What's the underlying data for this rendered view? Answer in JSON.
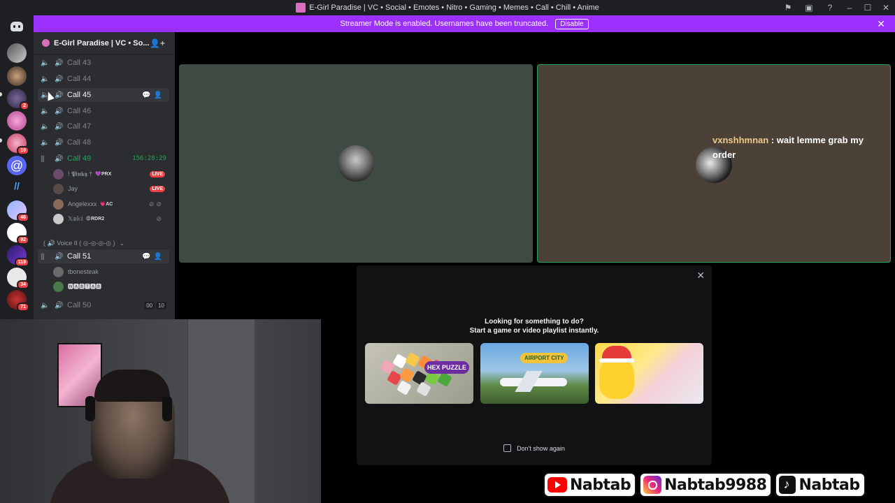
{
  "window": {
    "title": "E-Girl Paradise | VC • Social • Emotes • Nitro • Gaming • Memes • Call • Chill • Anime",
    "controls": {
      "minimize": "–",
      "maximize": "☐",
      "close": "✕"
    }
  },
  "banner": {
    "text": "Streamer Mode is enabled. Usernames have been truncated.",
    "disable_label": "Disable",
    "color": "#9b30ff"
  },
  "rail": {
    "servers": [
      {
        "name": "server-1"
      },
      {
        "name": "server-2"
      },
      {
        "name": "server-3",
        "badge": "2"
      },
      {
        "name": "server-4"
      },
      {
        "name": "server-5",
        "badge": "10"
      },
      {
        "name": "server-6"
      },
      {
        "name": "server-7"
      },
      {
        "name": "server-8",
        "badge": "46"
      },
      {
        "name": "server-9",
        "badge": "92"
      },
      {
        "name": "server-10",
        "badge": "119"
      },
      {
        "name": "server-11",
        "badge": "34"
      },
      {
        "name": "server-12",
        "badge": "71"
      }
    ]
  },
  "sidebar": {
    "server_name": "E-Girl Paradise | VC • So...",
    "channels_top": [
      {
        "label": "Call 43"
      },
      {
        "label": "Call 44"
      },
      {
        "label": "Call 45"
      },
      {
        "label": "Call 46"
      },
      {
        "label": "Call 47"
      },
      {
        "label": "Call 48"
      }
    ],
    "active_call": {
      "label": "Call 49",
      "timer": "156:28:29",
      "members": [
        {
          "name": "! 𝕻𝖎𝖓𝖐𝖞 †",
          "tag": "💜PRX",
          "live": "LIVE"
        },
        {
          "name": "Jay",
          "live": "LIVE"
        },
        {
          "name": "Angelexxx",
          "tag": "💗AC"
        },
        {
          "name": "𝕏𝕠𝕜𝕚",
          "tag": "😡RDR2"
        }
      ]
    },
    "category": "( 🔊 Voice II ( ◎-◎-◎-◎ )",
    "call51": {
      "label": "Call 51",
      "members": [
        {
          "name": "tbonesteak"
        },
        {
          "name": "🅽🅰🅱🆃🅰🅱"
        }
      ]
    },
    "call50": {
      "label": "Call 50",
      "count_current": "00",
      "count_max": "10"
    }
  },
  "main": {
    "chat_user": "vxnshhmnan",
    "chat_message": " : wait lemme grab my order",
    "activity": {
      "title_line1": "Looking for something to do?",
      "title_line2": "Start a game or video playlist instantly.",
      "games": [
        {
          "name": "Hex Puzzle",
          "badge": "HEX PUZZLE"
        },
        {
          "name": "Airport City",
          "badge": "AIRPORT CITY"
        },
        {
          "name": "Chick holiday game"
        }
      ],
      "dont_show": "Don't show again"
    }
  },
  "socials": [
    {
      "platform": "youtube",
      "handle": "Nabtab"
    },
    {
      "platform": "instagram",
      "handle": "Nabtab9988"
    },
    {
      "platform": "tiktok",
      "handle": "Nabtab"
    }
  ]
}
